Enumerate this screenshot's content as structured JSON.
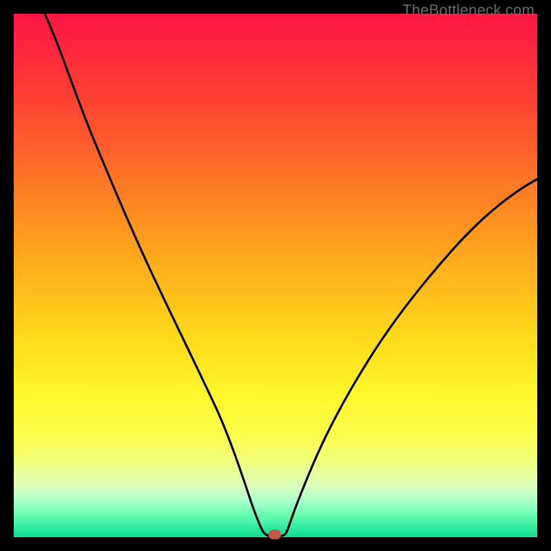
{
  "watermark": "TheBottleneck.com",
  "chart_data": {
    "type": "line",
    "title": "",
    "xlabel": "",
    "ylabel": "",
    "xlim": [
      0,
      100
    ],
    "ylim": [
      0,
      100
    ],
    "grid": false,
    "series": [
      {
        "name": "bottleneck-curve",
        "x": [
          6,
          10,
          15,
          20,
          25,
          30,
          35,
          40,
          42,
          44,
          46,
          47,
          48,
          50,
          52,
          55,
          60,
          65,
          70,
          75,
          80,
          85,
          90,
          95,
          100
        ],
        "values": [
          100,
          92,
          82,
          72,
          63,
          54,
          45,
          32,
          24,
          15,
          6,
          2,
          0,
          0,
          1,
          6,
          16,
          25,
          34,
          42,
          49,
          55,
          60,
          64,
          68
        ]
      }
    ],
    "marker": {
      "x": 49,
      "y": 0,
      "name": "bottleneck-point"
    },
    "background_gradient": {
      "top": "#ff1744",
      "mid": "#ffd81e",
      "bottom": "#14dc91"
    }
  }
}
